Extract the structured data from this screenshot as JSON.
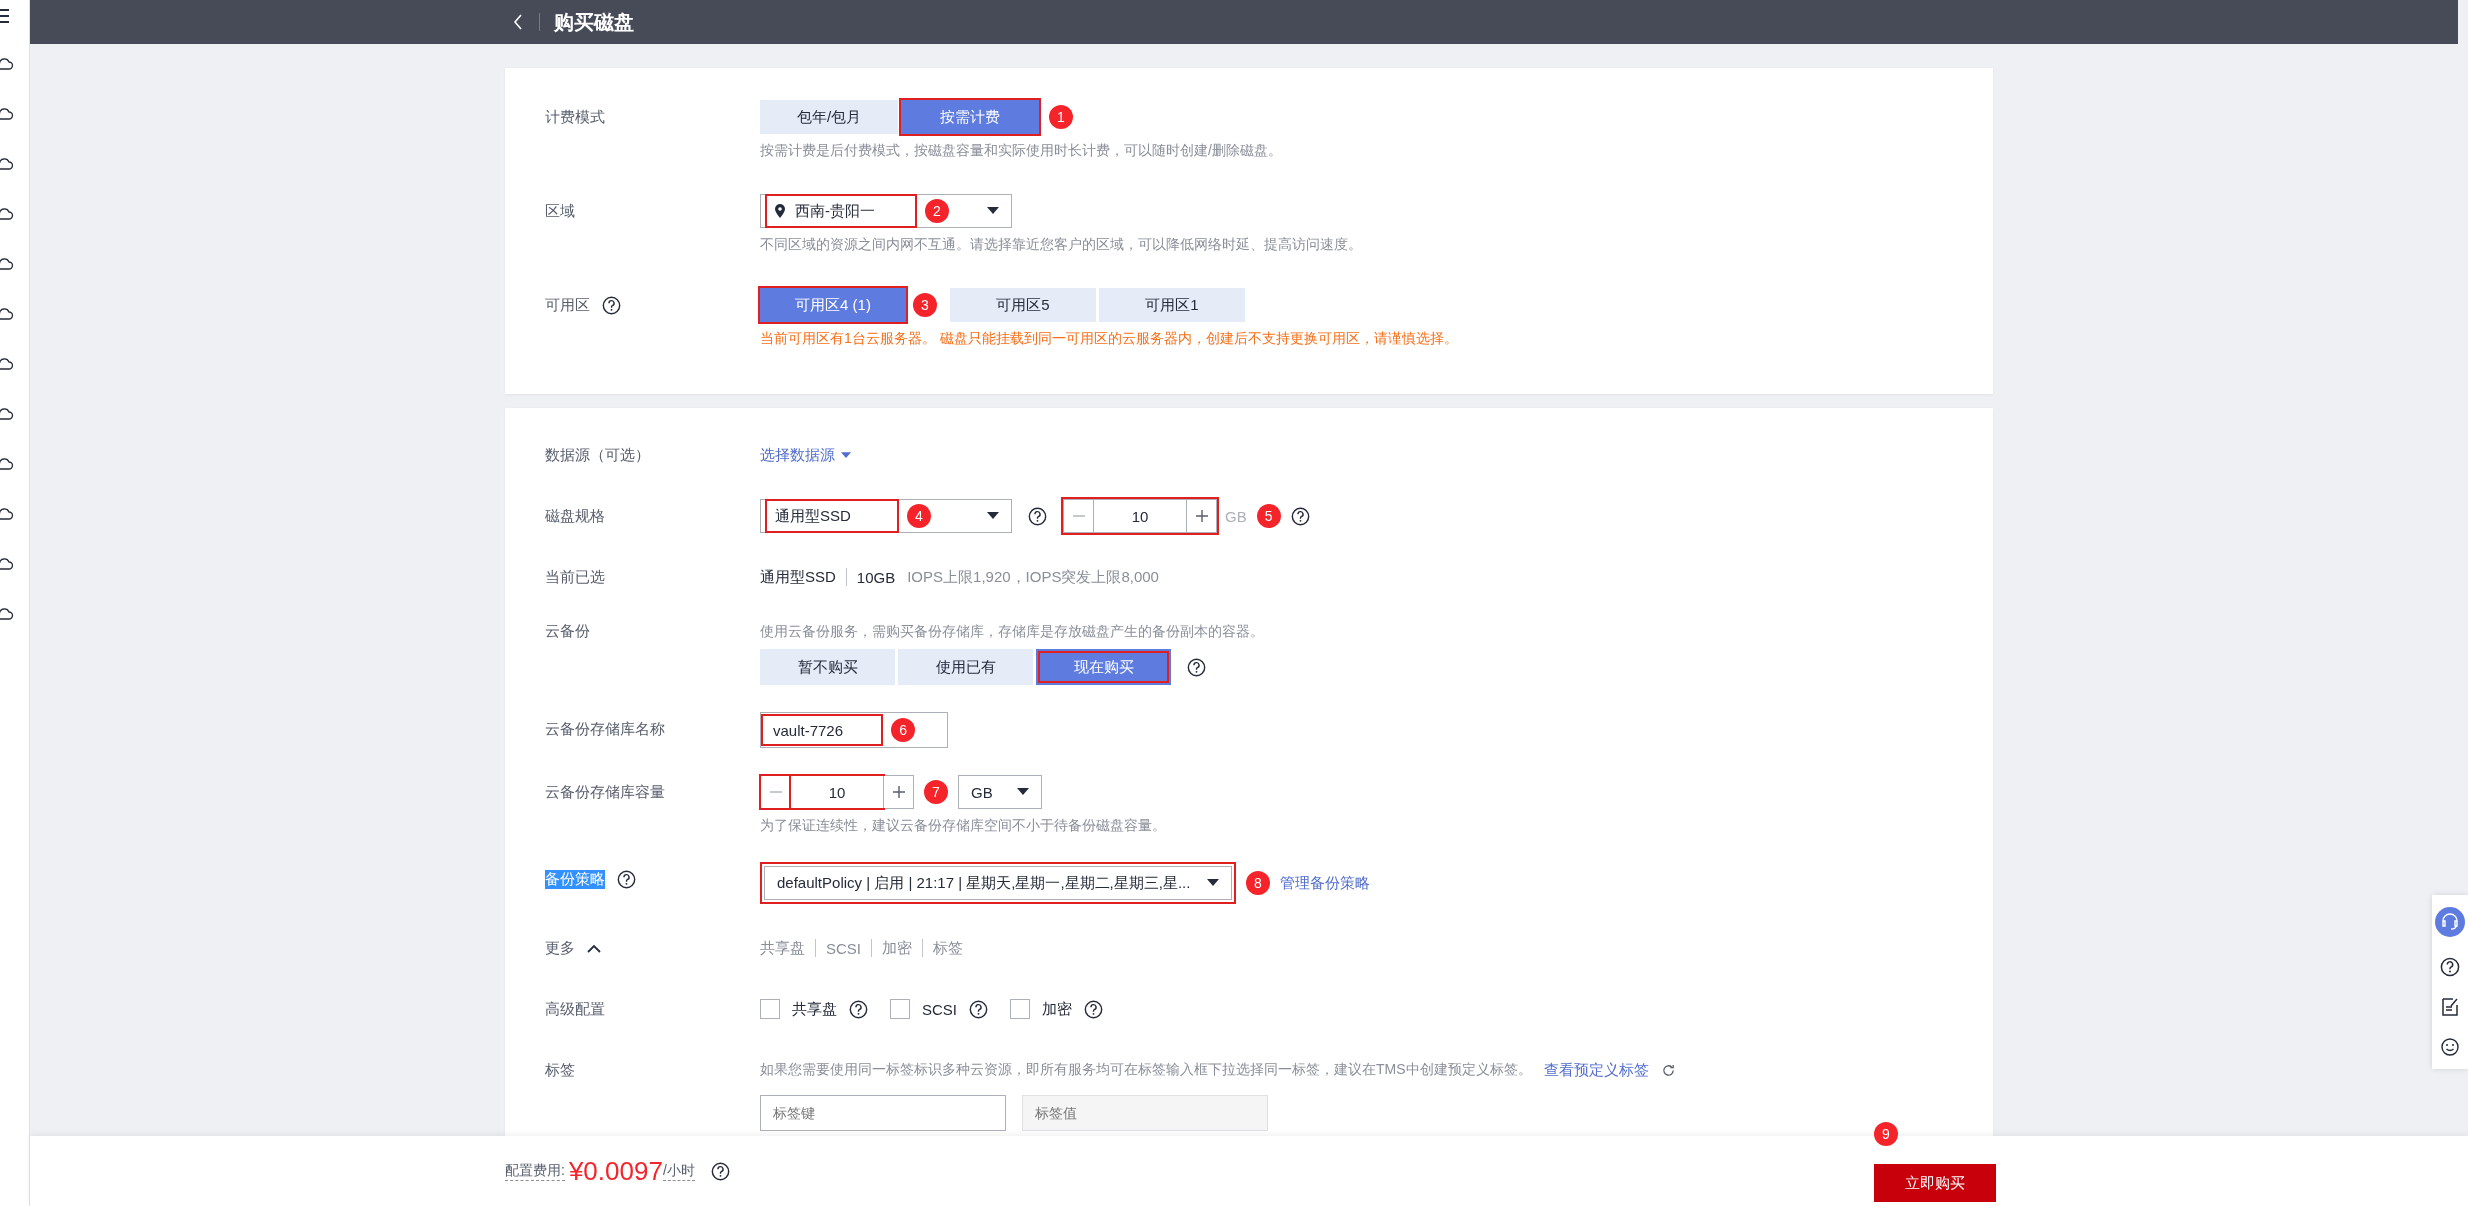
{
  "header": {
    "title": "购买磁盘"
  },
  "billing": {
    "label": "计费模式",
    "options": [
      {
        "label": "包年/包月",
        "selected": false,
        "boxed": false
      },
      {
        "label": "按需计费",
        "selected": true,
        "boxed": true,
        "marker": "1"
      }
    ],
    "hint": "按需计费是后付费模式，按磁盘容量和实际使用时长计费，可以随时创建/删除磁盘。"
  },
  "region": {
    "label": "区域",
    "value": "西南-贵阳一",
    "boxed": true,
    "marker": "2",
    "hint": "不同区域的资源之间内网不互通。请选择靠近您客户的区域，可以降低网络时延、提高访问速度。"
  },
  "zone": {
    "label": "可用区",
    "options": [
      {
        "label": "可用区4 (1)",
        "selected": true,
        "boxed": true,
        "marker": "3"
      },
      {
        "label": "可用区5",
        "selected": false,
        "boxed": false
      },
      {
        "label": "可用区1",
        "selected": false,
        "boxed": false
      }
    ],
    "warning": "当前可用区有1台云服务器。 磁盘只能挂载到同一可用区的云服务器内，创建后不支持更换可用区，请谨慎选择。"
  },
  "data_source": {
    "label": "数据源（可选）",
    "link": "选择数据源"
  },
  "disk_spec": {
    "label": "磁盘规格",
    "type": "通用型SSD",
    "type_boxed": true,
    "type_marker": "4",
    "size": "10",
    "size_boxed": true,
    "unit": "GB",
    "size_marker": "5"
  },
  "current": {
    "label": "当前已选",
    "type": "通用型SSD",
    "size": "10GB",
    "specs": "IOPS上限1,920，IOPS突发上限8,000"
  },
  "backup": {
    "label": "云备份",
    "hint": "使用云备份服务，需购买备份存储库，存储库是存放磁盘产生的备份副本的容器。",
    "options": [
      {
        "label": "暂不购买",
        "selected": false,
        "boxed": false
      },
      {
        "label": "使用已有",
        "selected": false,
        "boxed": false
      },
      {
        "label": "现在购买",
        "selected": true,
        "boxed": true
      }
    ]
  },
  "vault_name": {
    "label": "云备份存储库名称",
    "value": "vault-7726",
    "boxed": true,
    "marker": "6"
  },
  "vault_capacity": {
    "label": "云备份存储库容量",
    "value": "10",
    "boxed": true,
    "marker": "7",
    "unit": "GB",
    "hint": "为了保证连续性，建议云备份存储库空间不小于待备份磁盘容量。"
  },
  "policy": {
    "label": "备份策略",
    "label_selected": true,
    "value": "defaultPolicy | 启用 | 21:17 | 星期天,星期一,星期二,星期三,星...",
    "boxed": true,
    "marker": "8",
    "link": "管理备份策略"
  },
  "more": {
    "label": "更多",
    "expanded": true,
    "summary": [
      "共享盘",
      "SCSI",
      "加密",
      "标签"
    ]
  },
  "advanced": {
    "label": "高级配置",
    "options": [
      {
        "label": "共享盘",
        "checked": false
      },
      {
        "label": "SCSI",
        "checked": false
      },
      {
        "label": "加密",
        "checked": false
      }
    ]
  },
  "tags": {
    "label": "标签",
    "hint": "如果您需要使用同一标签标识多种云资源，即所有服务均可在标签输入框下拉选择同一标签，建议在TMS中创建预定义标签。",
    "link": "查看预定义标签",
    "key_placeholder": "标签键",
    "value_placeholder": "标签值"
  },
  "footer": {
    "fee_label": "配置费用:",
    "price": "¥0.0097",
    "price_unit": "/小时",
    "buy": "立即购买",
    "marker": "9"
  }
}
